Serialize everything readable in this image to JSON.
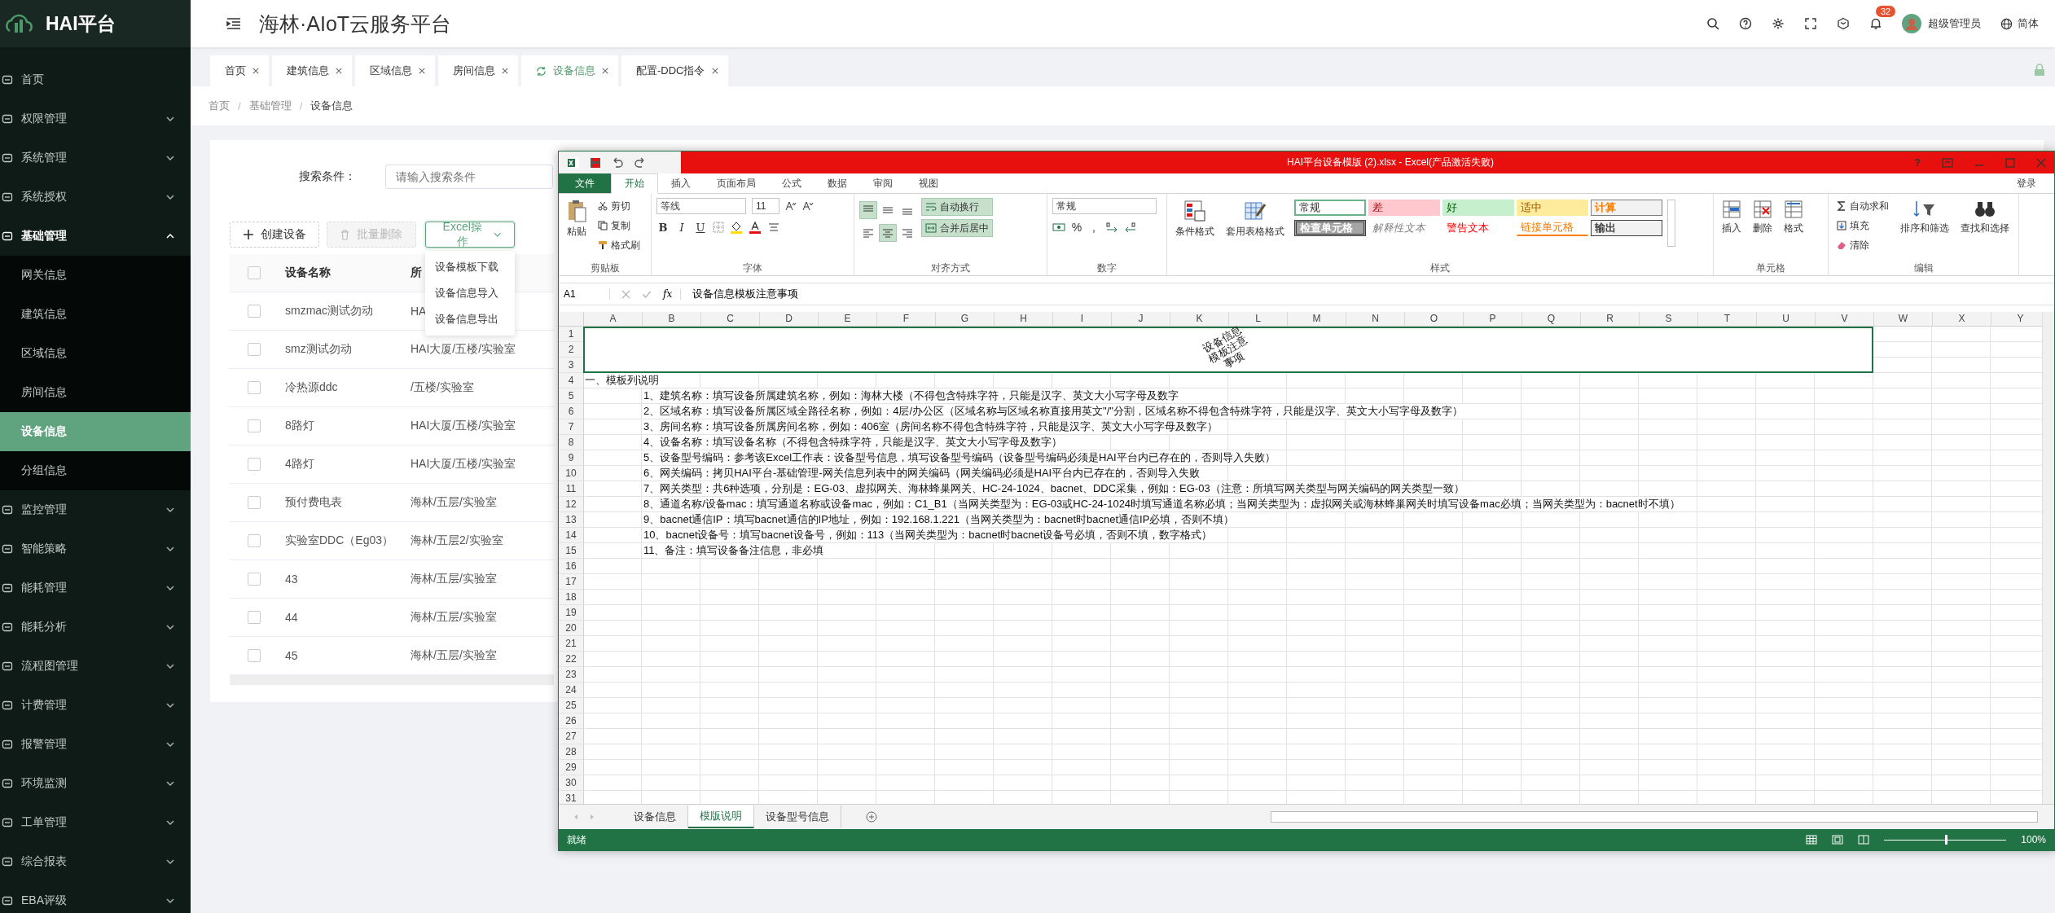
{
  "app": {
    "logo_text": "HAI平台",
    "title": "海林·AIoT云服务平台"
  },
  "sidebar": {
    "items": [
      {
        "label": "首页",
        "has_children": false,
        "expanded": false
      },
      {
        "label": "权限管理",
        "has_children": true,
        "expanded": false
      },
      {
        "label": "系统管理",
        "has_children": true,
        "expanded": false
      },
      {
        "label": "系统授权",
        "has_children": true,
        "expanded": false
      },
      {
        "label": "基础管理",
        "has_children": true,
        "expanded": true,
        "children": [
          {
            "label": "网关信息",
            "selected": false
          },
          {
            "label": "建筑信息",
            "selected": false
          },
          {
            "label": "区域信息",
            "selected": false
          },
          {
            "label": "房间信息",
            "selected": false
          },
          {
            "label": "设备信息",
            "selected": true
          },
          {
            "label": "分组信息",
            "selected": false
          }
        ]
      },
      {
        "label": "监控管理",
        "has_children": true,
        "expanded": false
      },
      {
        "label": "智能策略",
        "has_children": true,
        "expanded": false
      },
      {
        "label": "能耗管理",
        "has_children": true,
        "expanded": false
      },
      {
        "label": "能耗分析",
        "has_children": true,
        "expanded": false
      },
      {
        "label": "流程图管理",
        "has_children": true,
        "expanded": false
      },
      {
        "label": "计费管理",
        "has_children": true,
        "expanded": false
      },
      {
        "label": "报警管理",
        "has_children": true,
        "expanded": false
      },
      {
        "label": "环境监测",
        "has_children": true,
        "expanded": false
      },
      {
        "label": "工单管理",
        "has_children": true,
        "expanded": false
      },
      {
        "label": "综合报表",
        "has_children": true,
        "expanded": false
      },
      {
        "label": "EBA评级",
        "has_children": true,
        "expanded": false
      }
    ]
  },
  "header": {
    "notification_count": "32",
    "user": "超级管理员",
    "language": "简体"
  },
  "tabs": [
    {
      "label": "首页",
      "selected": false
    },
    {
      "label": "建筑信息",
      "selected": false
    },
    {
      "label": "区域信息",
      "selected": false
    },
    {
      "label": "房间信息",
      "selected": false
    },
    {
      "label": "设备信息",
      "selected": true
    },
    {
      "label": "配置-DDC指令",
      "selected": false
    }
  ],
  "breadcrumb": [
    {
      "kind": "link",
      "text": "首页"
    },
    {
      "kind": "separator",
      "text": "/"
    },
    {
      "kind": "link",
      "text": "基础管理"
    },
    {
      "kind": "separator",
      "text": "/"
    },
    {
      "kind": "current",
      "text": "设备信息"
    }
  ],
  "search": {
    "label": "搜索条件：",
    "placeholder": "请输入搜索条件"
  },
  "actions": [
    {
      "label": "创建设备",
      "kind": "create",
      "disabled": false
    },
    {
      "label": "批量删除",
      "kind": "delete",
      "disabled": true
    },
    {
      "label": "Excel操作",
      "kind": "dropdown",
      "disabled": false,
      "expanded": true,
      "items": [
        "设备模板下载",
        "设备信息导入",
        "设备信息导出"
      ]
    }
  ],
  "table": {
    "columns": [
      "设备名称",
      "所"
    ],
    "all_checked": false,
    "rows": [
      {
        "name": "smzmac测试勿动",
        "location": "HA",
        "checked": false
      },
      {
        "name": "smz测试勿动",
        "location": "HAI大厦/五楼/实验室",
        "checked": false
      },
      {
        "name": "冷热源ddc",
        "location": "/五楼/实验室",
        "checked": false
      },
      {
        "name": "8路灯",
        "location": "HAI大厦/五楼/实验室",
        "checked": false
      },
      {
        "name": "4路灯",
        "location": "HAI大厦/五楼/实验室",
        "checked": false
      },
      {
        "name": "预付费电表",
        "location": "海林/五层/实验室",
        "checked": false
      },
      {
        "name": "实验室DDC（Eg03）",
        "location": "海林/五层2/实验室",
        "checked": false
      },
      {
        "name": "43",
        "location": "海林/五层/实验室",
        "checked": false
      },
      {
        "name": "44",
        "location": "海林/五层/实验室",
        "checked": false
      },
      {
        "name": "45",
        "location": "海林/五层/实验室",
        "checked": false
      }
    ]
  },
  "excel": {
    "title": "HAI平台设备模版 (2).xlsx -  Excel(产品激活失败)",
    "help": "?",
    "ribbon_tabs": [
      {
        "label": "文件",
        "kind": "file",
        "selected": false
      },
      {
        "label": "开始",
        "kind": "tab",
        "selected": true
      },
      {
        "label": "插入",
        "kind": "tab",
        "selected": false
      },
      {
        "label": "页面布局",
        "kind": "tab",
        "selected": false
      },
      {
        "label": "公式",
        "kind": "tab",
        "selected": false
      },
      {
        "label": "数据",
        "kind": "tab",
        "selected": false
      },
      {
        "label": "审阅",
        "kind": "tab",
        "selected": false
      },
      {
        "label": "视图",
        "kind": "tab",
        "selected": false
      }
    ],
    "signin": "登录",
    "clipboard": {
      "title": "剪贴板",
      "paste": "粘贴",
      "cut": "剪切",
      "copy": "复制",
      "format_painter": "格式刷"
    },
    "font": {
      "title": "字体",
      "name": "等线",
      "size": "11",
      "bold": "B",
      "italic": "I",
      "underline": "U"
    },
    "alignment": {
      "title": "对齐方式",
      "buttons": [
        {
          "kind": "top",
          "selected": true
        },
        {
          "kind": "middle",
          "selected": false
        },
        {
          "kind": "bottom",
          "selected": false
        },
        {
          "kind": "left",
          "selected": false
        },
        {
          "kind": "center",
          "selected": true
        },
        {
          "kind": "right",
          "selected": false
        }
      ],
      "wrap": "自动换行",
      "wrap_on": true,
      "merge": "合并后居中",
      "merge_on": true
    },
    "number": {
      "title": "数字",
      "format": "常规",
      "percent": "%",
      "comma": ","
    },
    "styles": {
      "title": "样式",
      "conditional": "条件格式",
      "table_format": "套用表格格式",
      "cells": [
        {
          "label": "常规",
          "kind": "normal",
          "selected": true
        },
        {
          "label": "差",
          "kind": "bad",
          "selected": false
        },
        {
          "label": "好",
          "kind": "good",
          "selected": false
        },
        {
          "label": "适中",
          "kind": "neutral",
          "selected": false
        },
        {
          "label": "计算",
          "kind": "calculation",
          "selected": false
        },
        {
          "label": "检查单元格",
          "kind": "check",
          "selected": false
        },
        {
          "label": "解释性文本",
          "kind": "explanatory",
          "selected": false
        },
        {
          "label": "警告文本",
          "kind": "warning",
          "selected": false
        },
        {
          "label": "链接单元格",
          "kind": "linked",
          "selected": false
        },
        {
          "label": "输出",
          "kind": "output",
          "selected": false
        }
      ]
    },
    "cells": {
      "title": "单元格",
      "insert": "插入",
      "delete": "删除",
      "format": "格式"
    },
    "editing": {
      "title": "编辑",
      "autosum": "自动求和",
      "fill": "填充",
      "clear": "清除",
      "sort": "排序和筛选",
      "find": "查找和选择"
    },
    "name_box": "A1",
    "fx": "fx",
    "formula": "设备信息模板注意事项",
    "columns": [
      "A",
      "B",
      "C",
      "D",
      "E",
      "F",
      "G",
      "H",
      "I",
      "J",
      "K",
      "L",
      "M",
      "N",
      "O",
      "P",
      "Q",
      "R",
      "S",
      "T",
      "U",
      "V",
      "W",
      "X",
      "Y"
    ],
    "merged_title": "设备信息模板注意事项",
    "rows": [
      {
        "header": "1",
        "merged": true
      },
      {
        "header": "2",
        "merged": true
      },
      {
        "header": "3",
        "merged": true
      },
      {
        "header": "4",
        "indented": false,
        "text": "一、模板列说明"
      },
      {
        "header": "5",
        "indented": true,
        "text": "1、建筑名称：填写设备所属建筑名称，例如：海林大楼（不得包含特殊字符，只能是汉字、英文大小写字母及数字"
      },
      {
        "header": "6",
        "indented": true,
        "text": "2、区域名称：填写设备所属区域全路径名称，例如：4层/办公区（区域名称与区域名称直接用英文\"/\"分割，区域名称不得包含特殊字符，只能是汉字、英文大小写字母及数字）"
      },
      {
        "header": "7",
        "indented": true,
        "text": "3、房间名称：填写设备所属房间名称，例如：406室（房间名称不得包含特殊字符，只能是汉字、英文大小写字母及数字）"
      },
      {
        "header": "8",
        "indented": true,
        "text": "4、设备名称：填写设备名称（不得包含特殊字符，只能是汉字、英文大小写字母及数字）"
      },
      {
        "header": "9",
        "indented": true,
        "text": "5、设备型号编码：参考该Excel工作表：设备型号信息，填写设备型号编码（设备型号编码必须是HAI平台内已存在的，否则导入失败）"
      },
      {
        "header": "10",
        "indented": true,
        "text": "6、网关编码：拷贝HAI平台-基础管理-网关信息列表中的网关编码（网关编码必须是HAI平台内已存在的，否则导入失败"
      },
      {
        "header": "11",
        "indented": true,
        "text": "7、网关类型：共6种选项，分别是：EG-03、虚拟网关、海林蜂巢网关、HC-24-1024、bacnet、DDC采集，例如：EG-03（注意：所填写网关类型与网关编码的网关类型一致）"
      },
      {
        "header": "12",
        "indented": true,
        "text": "8、通道名称/设备mac：填写通道名称或设备mac，例如：C1_B1（当网关类型为：EG-03或HC-24-1024时填写通道名称必填；当网关类型为：虚拟网关或海林蜂巢网关时填写设备mac必填；当网关类型为：bacnet时不填）"
      },
      {
        "header": "13",
        "indented": true,
        "text": "9、bacnet通信IP：填写bacnet通信的IP地址，例如：192.168.1.221（当网关类型为：bacnet时bacnet通信IP必填，否则不填）"
      },
      {
        "header": "14",
        "indented": true,
        "text": "10、bacnet设备号：填写bacnet设备号，例如：113（当网关类型为：bacnet时bacnet设备号必填，否则不填，数字格式）"
      },
      {
        "header": "15",
        "indented": true,
        "text": "11、备注：填写设备备注信息，非必填"
      },
      {
        "header": "16"
      },
      {
        "header": "17"
      },
      {
        "header": "18"
      },
      {
        "header": "19"
      },
      {
        "header": "20"
      },
      {
        "header": "21"
      },
      {
        "header": "22"
      },
      {
        "header": "23"
      },
      {
        "header": "24"
      },
      {
        "header": "25"
      },
      {
        "header": "26"
      },
      {
        "header": "27"
      },
      {
        "header": "28"
      },
      {
        "header": "29"
      },
      {
        "header": "30"
      },
      {
        "header": "31"
      }
    ],
    "sheets": [
      {
        "label": "设备信息",
        "selected": false
      },
      {
        "label": "模版说明",
        "selected": true
      },
      {
        "label": "设备型号信息",
        "selected": false
      }
    ],
    "status": "就绪",
    "zoom": "100%",
    "zoom_slider": {
      "level": 0.5
    }
  }
}
